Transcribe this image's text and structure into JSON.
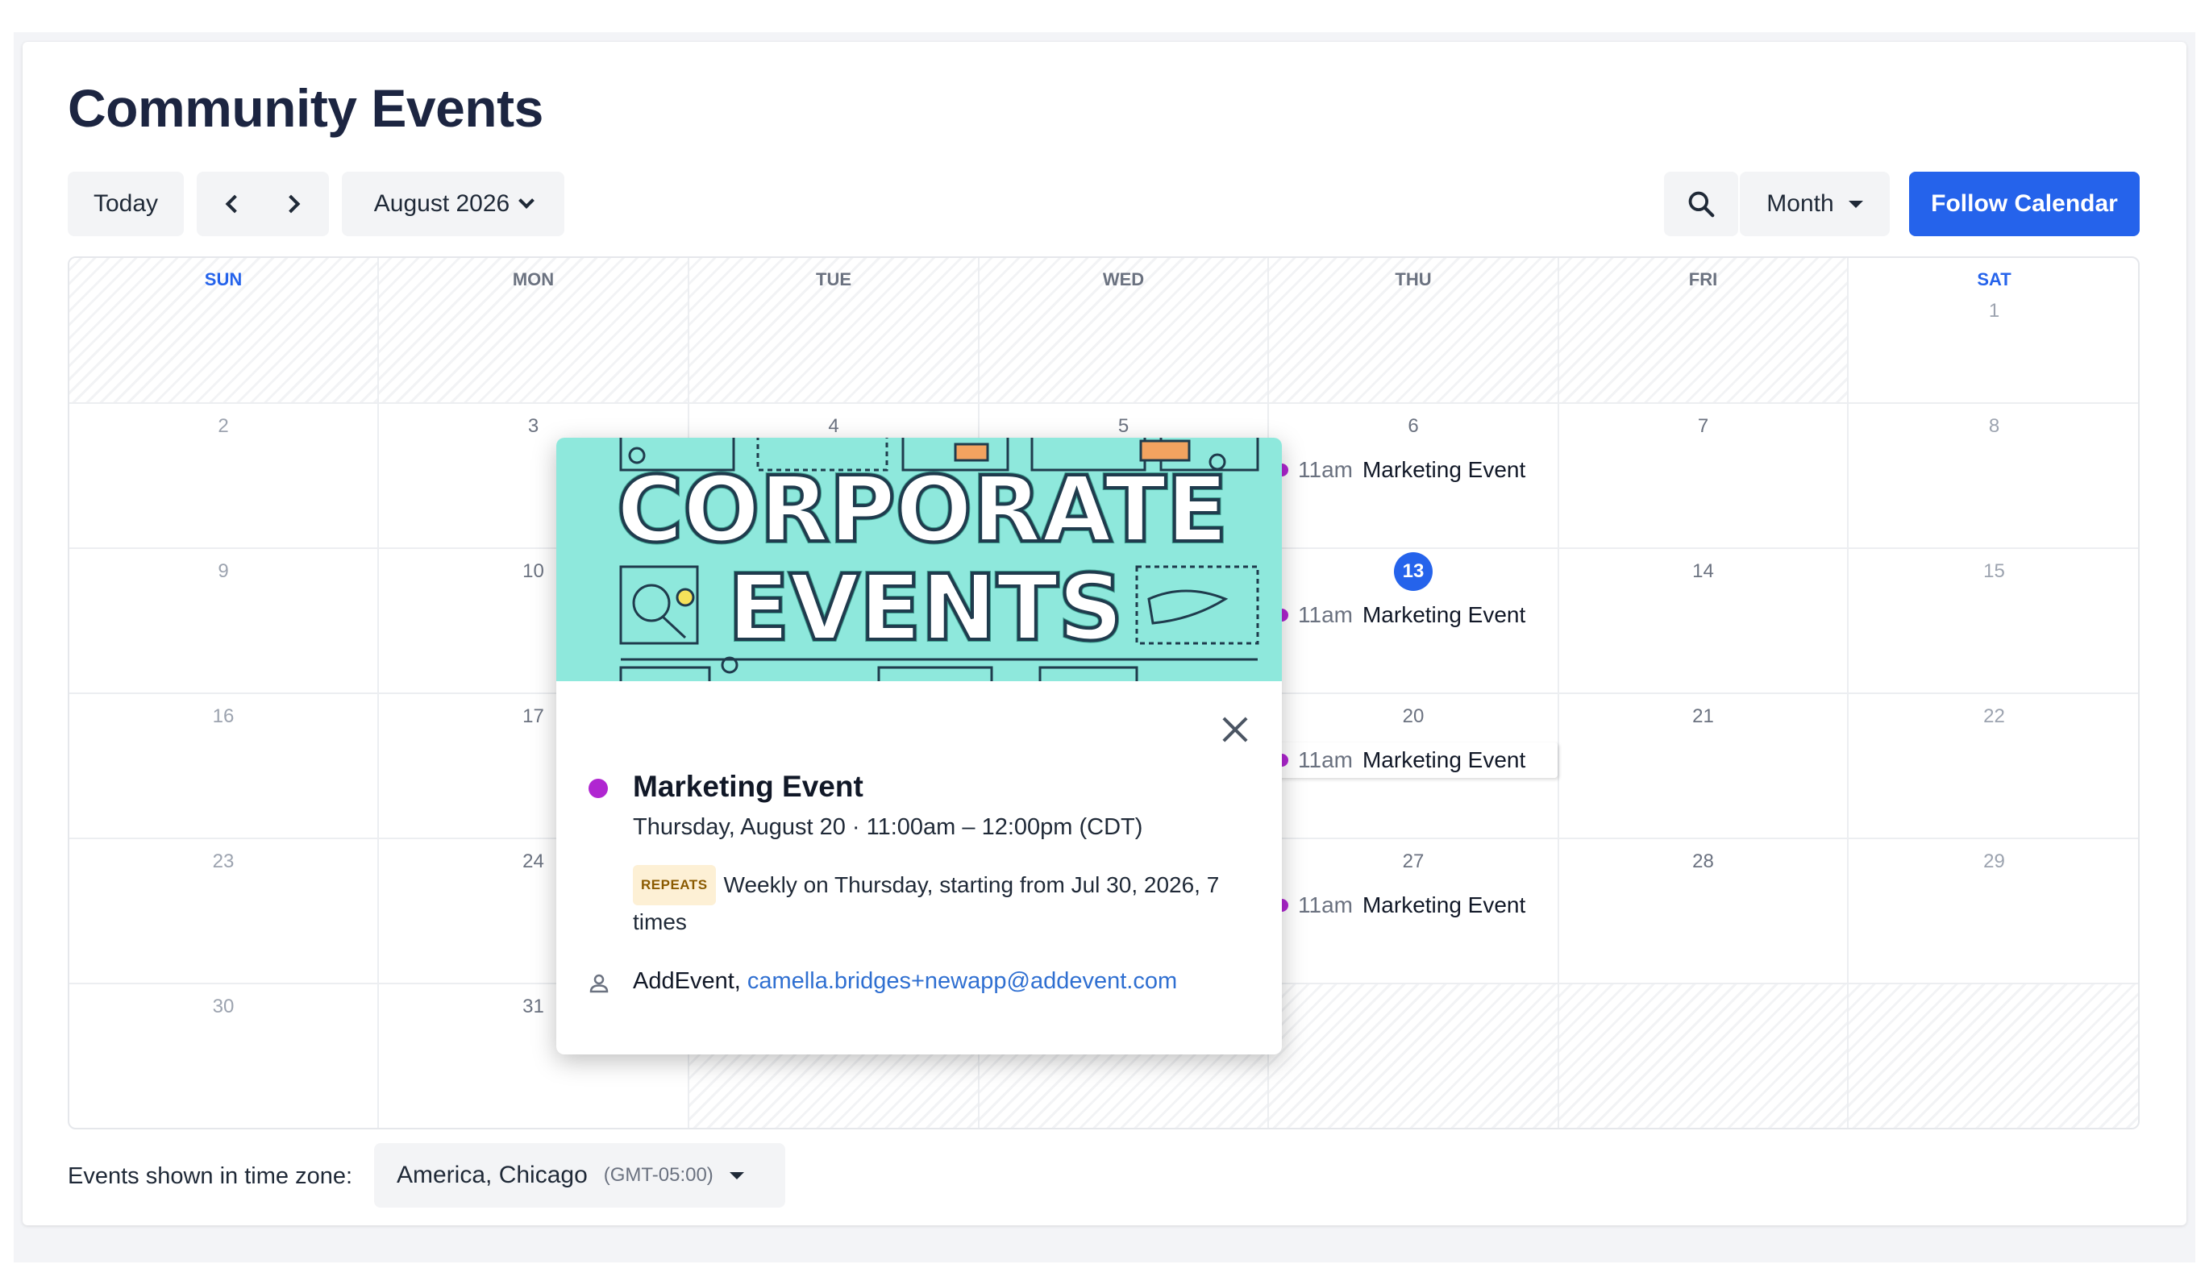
{
  "page": {
    "title": "Community Events"
  },
  "toolbar": {
    "today_label": "Today",
    "month_label": "August 2026",
    "view_label": "Month",
    "follow_label": "Follow Calendar",
    "icons": [
      "chevron-left-icon",
      "chevron-right-icon",
      "chevron-down-icon",
      "search-icon",
      "caret-down-icon"
    ]
  },
  "colors": {
    "accent": "#2563eb",
    "event_dot": "#b026d1",
    "title": "#1c2541",
    "banner": "#8ee8dc"
  },
  "calendar": {
    "weekdays": [
      "SUN",
      "MON",
      "TUE",
      "WED",
      "THU",
      "FRI",
      "SAT"
    ],
    "today": "13",
    "weeks": [
      [
        "",
        "",
        "",
        "",
        "",
        "",
        "1"
      ],
      [
        "2",
        "3",
        "4",
        "5",
        "6",
        "7",
        "8"
      ],
      [
        "9",
        "10",
        "",
        "",
        "13",
        "14",
        "15"
      ],
      [
        "16",
        "17",
        "",
        "",
        "20",
        "21",
        "22"
      ],
      [
        "23",
        "24",
        "",
        "",
        "27",
        "28",
        "29"
      ],
      [
        "30",
        "31",
        "",
        "",
        "",
        "",
        ""
      ]
    ],
    "events": [
      {
        "time": "11am",
        "name": "Marketing Event"
      },
      {
        "time": "11am",
        "name": "Marketing Event"
      },
      {
        "time": "11am",
        "name": "Marketing Event"
      },
      {
        "time": "11am",
        "name": "Marketing Event"
      }
    ]
  },
  "popup": {
    "banner_line1": "CORPORATE",
    "banner_line2": "EVENTS",
    "title": "Marketing Event",
    "when": "Thursday, August 20 · 11:00am – 12:00pm (CDT)",
    "repeats_badge": "REPEATS",
    "repeats_text": "Weekly on Thursday, starting from Jul 30, 2026, 7 times",
    "organizer": "AddEvent,",
    "organizer_email": "camella.bridges+newapp@addevent.com"
  },
  "timezone": {
    "label": "Events shown in time zone:",
    "city": "America, Chicago",
    "offset": "(GMT-05:00)"
  }
}
